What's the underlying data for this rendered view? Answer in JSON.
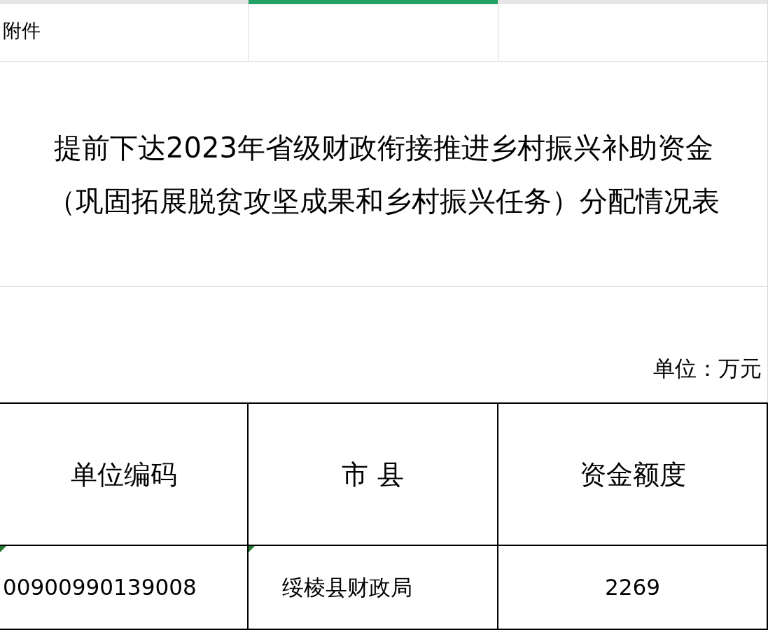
{
  "column_strip": [
    {
      "selected": false
    },
    {
      "selected": true
    },
    {
      "selected": false
    }
  ],
  "attachment_label": "附件",
  "title_lines": [
    "提前下达2023年省级财政衔接推进乡村振兴补助资金",
    "（巩固拓展脱贫攻坚成果和乡村振兴任务）分配情况表"
  ],
  "unit_note": "单位：万元",
  "table": {
    "columns": [
      "单位编码",
      "市 县",
      "资金额度"
    ],
    "rows": [
      {
        "cells": [
          "00900990139008",
          "绥棱县财政局",
          "2269"
        ],
        "text_marks": [
          true,
          true,
          false
        ]
      }
    ]
  }
}
